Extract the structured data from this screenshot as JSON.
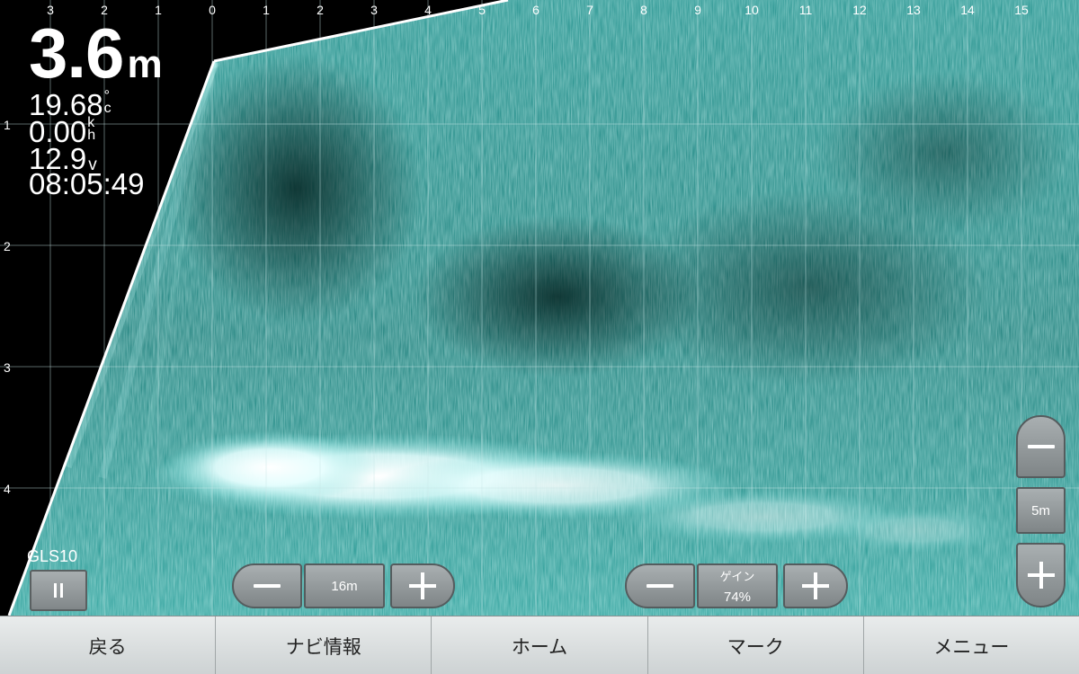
{
  "readout": {
    "depth_value": "3.6",
    "depth_unit": "m",
    "temperature": "19.68",
    "temperature_unit": "°c",
    "speed": "0.00",
    "speed_unit": "kh",
    "voltage": "12.9",
    "voltage_unit": "v",
    "clock": "08:05:49"
  },
  "x_axis_ticks": [
    "3",
    "2",
    "1",
    "0",
    "1",
    "2",
    "3",
    "4",
    "5",
    "6",
    "7",
    "8",
    "9",
    "10",
    "11",
    "12",
    "13",
    "14",
    "15"
  ],
  "y_axis_ticks": [
    "1",
    "2",
    "3",
    "4"
  ],
  "transducer": {
    "label": "GLS10"
  },
  "range_control": {
    "value": "16m"
  },
  "gain_control": {
    "label": "ゲイン",
    "value": "74%",
    "level_percent": 74
  },
  "zoom_control": {
    "value": "5m"
  },
  "nav": [
    {
      "label": "戻る"
    },
    {
      "label": "ナビ情報"
    },
    {
      "label": "ホーム"
    },
    {
      "label": "マーク"
    },
    {
      "label": "メニュー"
    }
  ],
  "colors": {
    "sonar_return": "#2bc6c0",
    "sonar_strong": "#ffffff",
    "background": "#000000",
    "grid": "#c8e6e6"
  },
  "icons": {
    "pause": "pause-icon",
    "minus": "minus-icon",
    "plus": "plus-icon"
  }
}
